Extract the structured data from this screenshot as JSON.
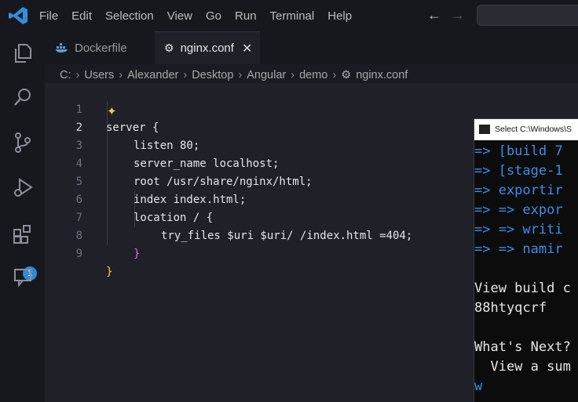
{
  "menu": [
    "File",
    "Edit",
    "Selection",
    "View",
    "Go",
    "Run",
    "Terminal",
    "Help"
  ],
  "nav": {
    "back": "←",
    "forward": "→"
  },
  "tabs": [
    {
      "label": "Dockerfile",
      "icon": "docker-icon"
    },
    {
      "label": "nginx.conf",
      "icon": "gear-icon",
      "close": "✕"
    }
  ],
  "breadcrumb": [
    "C:",
    "Users",
    "Alexander",
    "Desktop",
    "Angular",
    "demo",
    "nginx.conf"
  ],
  "activity": {
    "extensions_badge": "1"
  },
  "code": [
    {
      "n": "1",
      "text": "server {"
    },
    {
      "n": "2",
      "text": "listen 80;"
    },
    {
      "n": "3",
      "text": "server_name localhost;"
    },
    {
      "n": "4",
      "text": "root /usr/share/nginx/html;"
    },
    {
      "n": "5",
      "text": "index index.html;"
    },
    {
      "n": "6",
      "text": "location / {"
    },
    {
      "n": "7",
      "text": "try_files $uri $uri/ /index.html =404;"
    },
    {
      "n": "8",
      "text": "}"
    },
    {
      "n": "9",
      "text": "}"
    }
  ],
  "terminal": {
    "title": "Select C:\\Windows\\S",
    "lines": [
      "=> [build 7",
      "=> [stage-1",
      "=> exportir",
      "=> => expor",
      "=> => writi",
      "=> => namir",
      "",
      "View build c",
      "88htyqcrf",
      "",
      "What's Next?",
      "  View a sum",
      "w"
    ]
  }
}
